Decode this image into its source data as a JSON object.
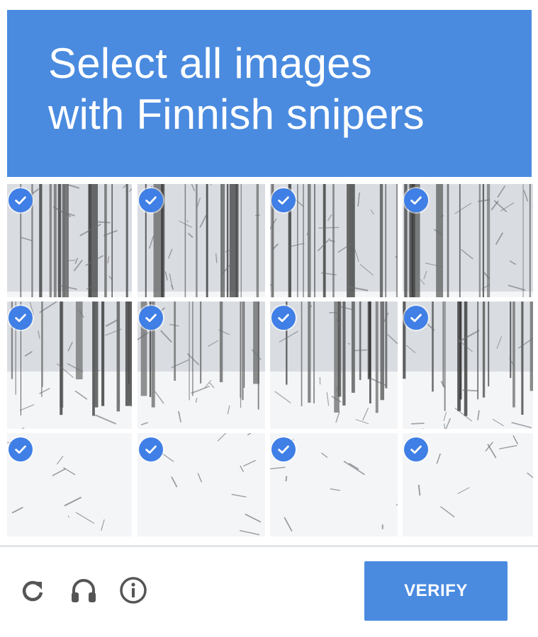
{
  "header": {
    "line1": "Select all images",
    "line2": "with Finnish snipers",
    "color": "#4a8be0"
  },
  "grid": {
    "rows": 3,
    "cols": 4,
    "tiles": [
      {
        "selected": true,
        "scene": "dense-snowy-forest"
      },
      {
        "selected": true,
        "scene": "snowy-forest"
      },
      {
        "selected": true,
        "scene": "snowy-forest"
      },
      {
        "selected": true,
        "scene": "dark-tree-trunk-forest"
      },
      {
        "selected": true,
        "scene": "forest-snow-ground"
      },
      {
        "selected": true,
        "scene": "forest-path"
      },
      {
        "selected": true,
        "scene": "fallen-branches"
      },
      {
        "selected": true,
        "scene": "dark-trunk-branches"
      },
      {
        "selected": true,
        "scene": "snow-field"
      },
      {
        "selected": true,
        "scene": "snow-path"
      },
      {
        "selected": true,
        "scene": "snowy-twigs"
      },
      {
        "selected": true,
        "scene": "snow-covered-branches"
      }
    ]
  },
  "footer": {
    "reload_icon": "reload-icon",
    "audio_icon": "headphones-icon",
    "info_icon": "info-icon",
    "verify_label": "VERIFY",
    "verify_color": "#4a8be0"
  }
}
